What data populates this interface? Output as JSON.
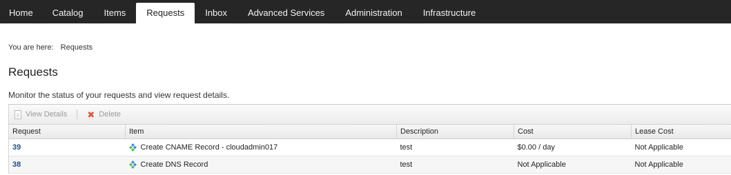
{
  "nav": {
    "tabs": [
      {
        "label": "Home"
      },
      {
        "label": "Catalog"
      },
      {
        "label": "Items"
      },
      {
        "label": "Requests"
      },
      {
        "label": "Inbox"
      },
      {
        "label": "Advanced Services"
      },
      {
        "label": "Administration"
      },
      {
        "label": "Infrastructure"
      }
    ],
    "active": "Requests"
  },
  "breadcrumb": {
    "prefix": "You are here:",
    "current": "Requests"
  },
  "page": {
    "title": "Requests",
    "subtitle": "Monitor the status of your requests and view request details."
  },
  "toolbar": {
    "view_details": "View Details",
    "delete": "Delete"
  },
  "table": {
    "columns": [
      "Request",
      "Item",
      "Description",
      "Cost",
      "Lease Cost"
    ],
    "rows": [
      {
        "request": "39",
        "item": "Create CNAME Record - cloudadmin017",
        "description": "test",
        "cost": "$0.00 / day",
        "lease_cost": "Not Applicable"
      },
      {
        "request": "38",
        "item": "Create DNS Record",
        "description": "test",
        "cost": "Not Applicable",
        "lease_cost": "Not Applicable"
      }
    ]
  },
  "colors": {
    "nav_bg": "#262626",
    "link": "#1f4f8a",
    "item_icon_blue": "#3a8fd6",
    "item_icon_green": "#5cb85c"
  }
}
